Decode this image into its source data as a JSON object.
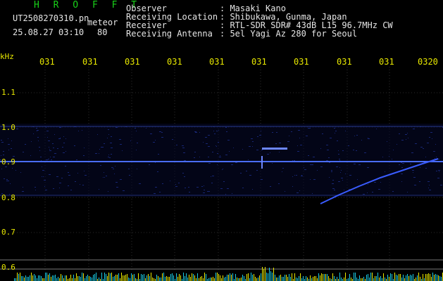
{
  "header": {
    "title": "H R O F F T",
    "file_name": "UT2508270310.pn",
    "meteor_label": "meteor",
    "timestamp": "25.08.27 03:10",
    "count": "80",
    "fields": [
      {
        "label": "Observer",
        "value": ": Masaki Kano"
      },
      {
        "label": "Receiving Location",
        "value": ": Shibukawa, Gunma, Japan"
      },
      {
        "label": "Receiver",
        "value": ": RTL-SDR SDR# 43dB L15 96.7MHz CW"
      },
      {
        "label": "Receiving Antenna",
        "value": ": 5el Yagi Az 280 for Seoul"
      }
    ]
  },
  "axis": {
    "unit": "kHz",
    "time_ticks": [
      "031",
      "031",
      "031",
      "031",
      "031",
      "031",
      "031",
      "031",
      "031",
      "0320"
    ],
    "freq_ticks": [
      "1.1",
      "1.0",
      "0.9",
      "0.8",
      "0.7",
      "0.6"
    ]
  },
  "colors": {
    "background": "#000000",
    "title": "#19d219",
    "labels": "#e8e800",
    "signal": "#4a6dff",
    "meteor_trace": "#3a5cff",
    "grid": "#333333"
  }
}
